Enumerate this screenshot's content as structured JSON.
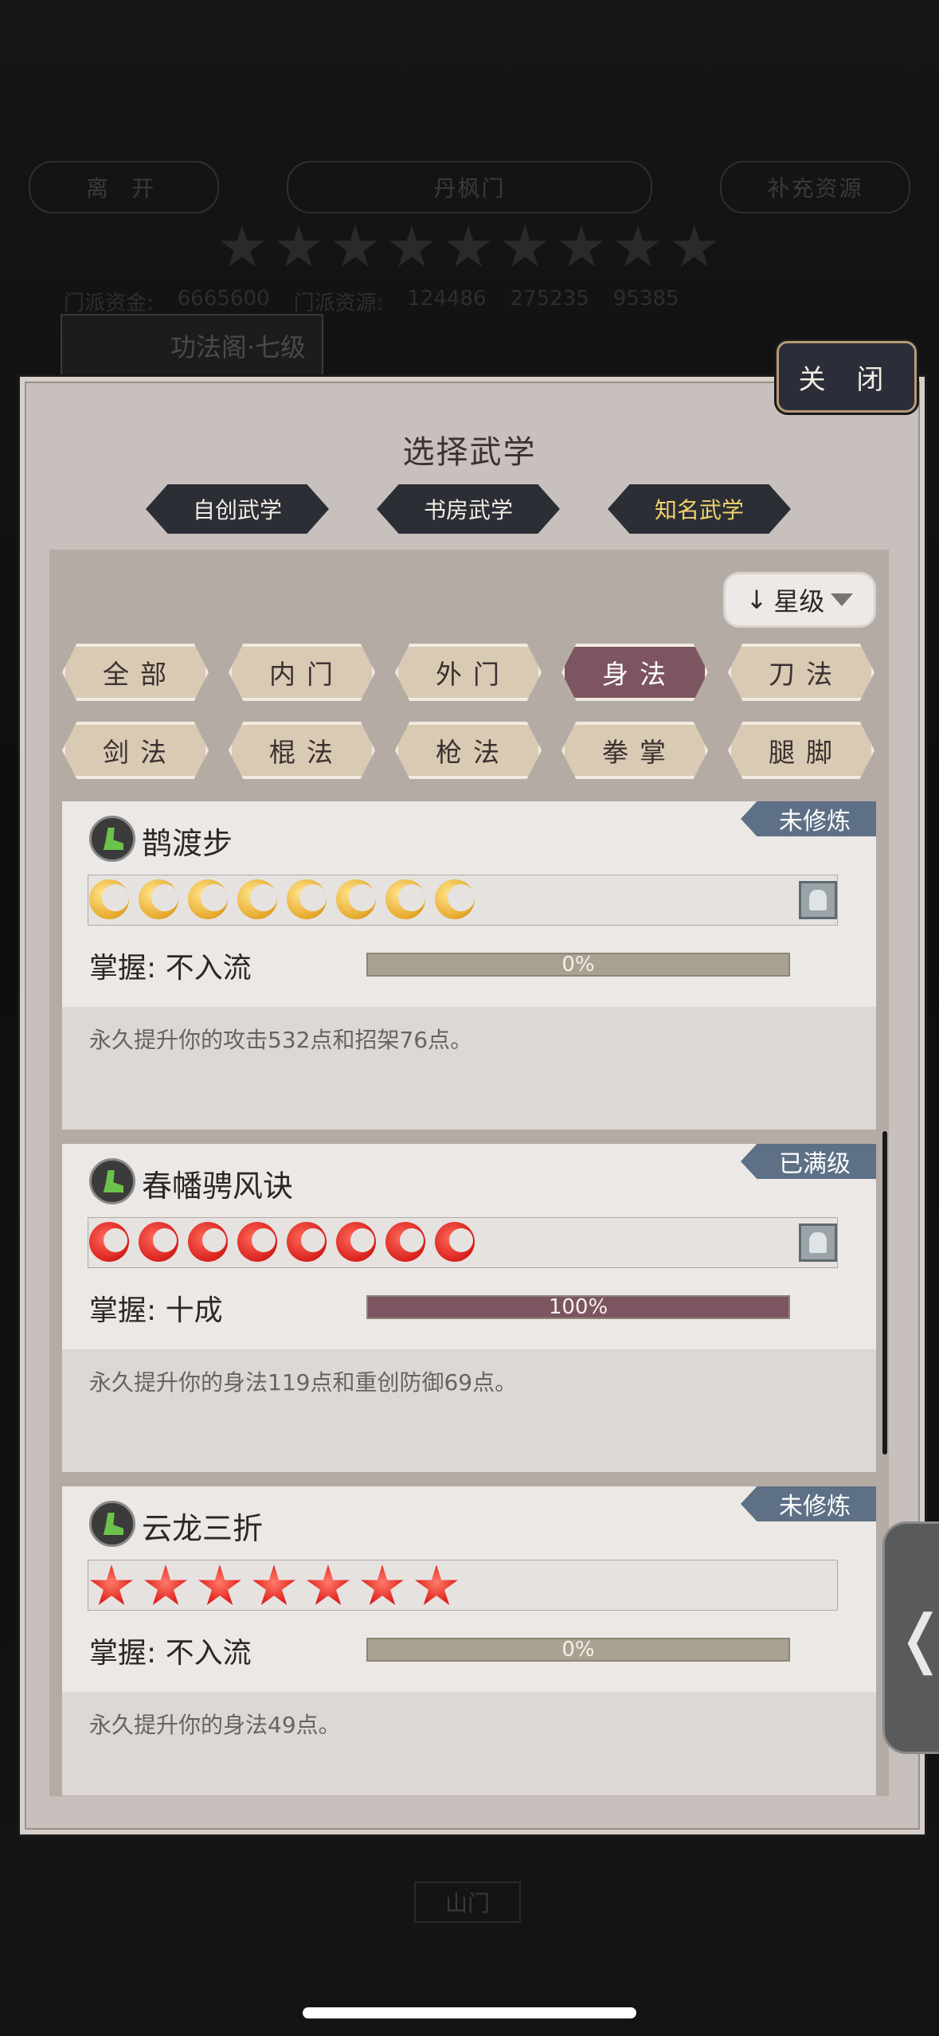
{
  "background": {
    "leave_button": "离 开",
    "sect_name": "丹枫门",
    "supplement_button": "补充资源",
    "sect_funds_label": "门派资金:",
    "sect_funds_value": "6665600",
    "sect_resources_label": "门派资源:",
    "sect_resources_value": "124486",
    "stat_a": "275235",
    "stat_b": "95385",
    "pavilion": "功法阁·七级",
    "gate": "山门"
  },
  "dialog": {
    "close_label": "关 闭",
    "title": "选择武学",
    "category_tabs": [
      {
        "label": "自创武学",
        "active": false
      },
      {
        "label": "书房武学",
        "active": false
      },
      {
        "label": "知名武学",
        "active": true
      }
    ],
    "sort_label": "星级",
    "filters": [
      {
        "label": "全部",
        "active": false
      },
      {
        "label": "内门",
        "active": false
      },
      {
        "label": "外门",
        "active": false
      },
      {
        "label": "身法",
        "active": true
      },
      {
        "label": "刀法",
        "active": false
      },
      {
        "label": "剑法",
        "active": false
      },
      {
        "label": "棍法",
        "active": false
      },
      {
        "label": "枪法",
        "active": false
      },
      {
        "label": "拳掌",
        "active": false
      },
      {
        "label": "腿脚",
        "active": false
      }
    ],
    "mastery_prefix": "掌握:",
    "skills": [
      {
        "name": "鹊渡步",
        "status": "未修炼",
        "rank_icon": "moon-icon",
        "rank_count": 8,
        "mastery": "不入流",
        "progress_text": "0%",
        "progress": 0,
        "description": "永久提升你的攻击532点和招架76点。"
      },
      {
        "name": "春幡骋风诀",
        "status": "已满级",
        "rank_icon": "flame-moon-icon",
        "rank_count": 8,
        "mastery": "十成",
        "progress_text": "100%",
        "progress": 1,
        "description": "永久提升你的身法119点和重创防御69点。"
      },
      {
        "name": "云龙三折",
        "status": "未修炼",
        "rank_icon": "star-icon",
        "rank_count": 7,
        "mastery": "不入流",
        "progress_text": "0%",
        "progress": 0,
        "description": "永久提升你的身法49点。"
      }
    ],
    "side_tab_glyph": "❬"
  },
  "colors": {
    "accent_active": "#7c5560",
    "badge": "#5d7085",
    "tab_dark": "#2c2e36",
    "tab_active_text": "#f0d36b"
  }
}
